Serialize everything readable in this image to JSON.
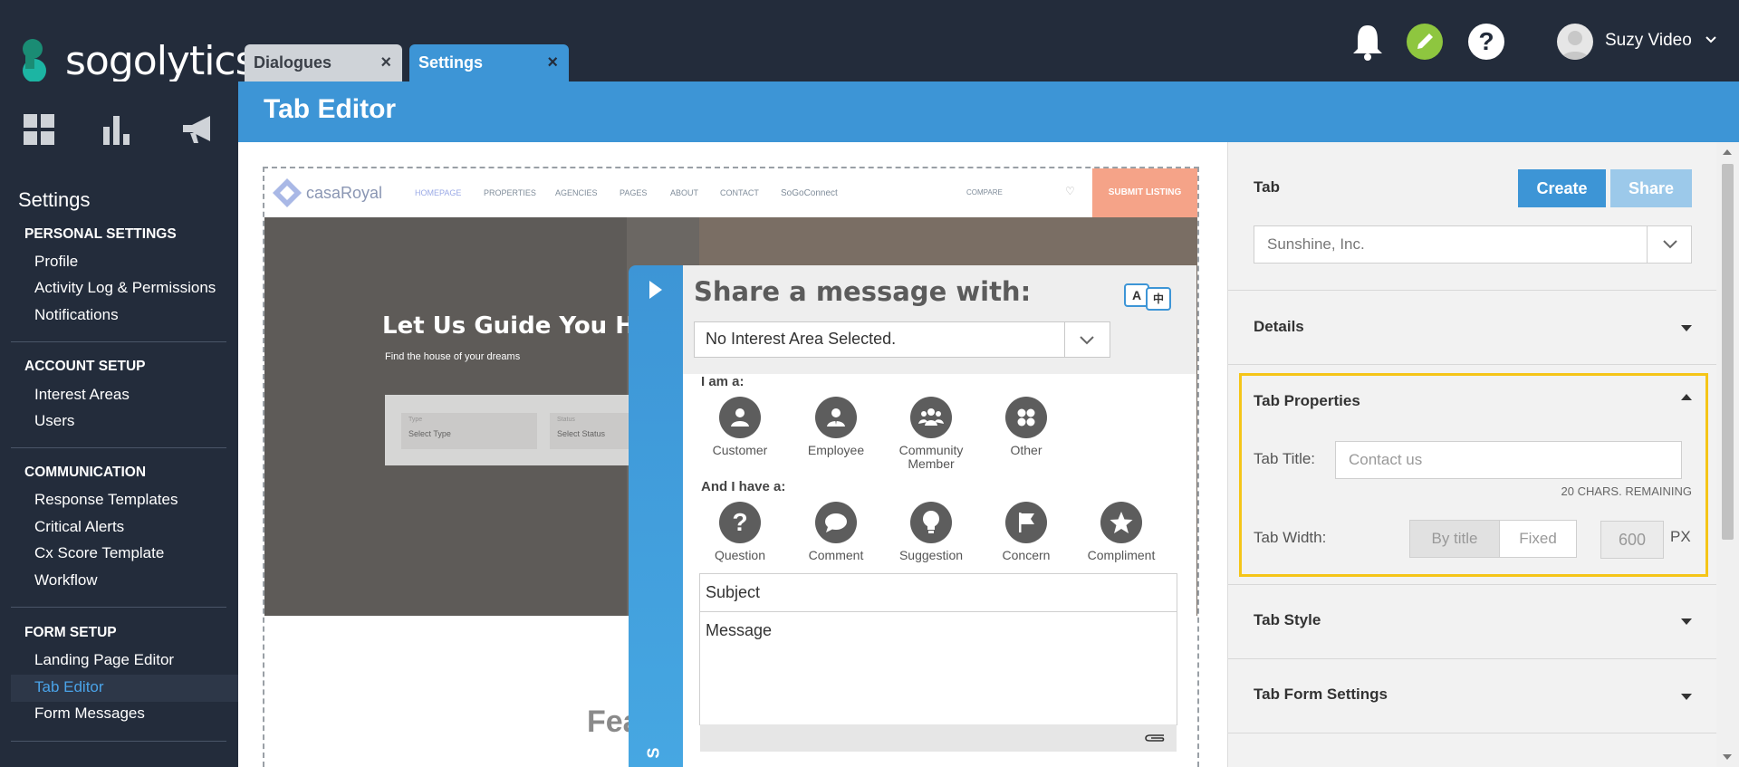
{
  "brand": {
    "name": "sogolytics"
  },
  "tabs": [
    {
      "label": "Dialogues",
      "close": "×"
    },
    {
      "label": "Settings",
      "close": "×"
    }
  ],
  "user": {
    "name": "Suzy Video"
  },
  "topbar": {
    "help_glyph": "?"
  },
  "sidebar": {
    "title": "Settings",
    "sections": [
      {
        "heading": "PERSONAL SETTINGS",
        "items": [
          "Profile",
          "Activity Log & Permissions",
          "Notifications"
        ]
      },
      {
        "heading": "ACCOUNT SETUP",
        "items": [
          "Interest Areas",
          "Users"
        ]
      },
      {
        "heading": "COMMUNICATION",
        "items": [
          "Response Templates",
          "Critical Alerts",
          "Cx Score Template",
          "Workflow"
        ]
      },
      {
        "heading": "FORM SETUP",
        "items": [
          "Landing Page Editor",
          "Tab Editor",
          "Form Messages"
        ]
      }
    ],
    "active_item": "Tab Editor"
  },
  "header": {
    "title": "Tab Editor"
  },
  "preview": {
    "site_logo": "casaRoyal",
    "nav": [
      "HOMEPAGE",
      "PROPERTIES",
      "AGENCIES",
      "PAGES",
      "ABOUT",
      "CONTACT",
      "SoGoConnect",
      "COMPARE"
    ],
    "submit": "SUBMIT LISTING",
    "hero_title": "Let Us Guide You Home",
    "hero_sub": "Find the house of your dreams",
    "type_label": "Type",
    "type_select": "Select Type",
    "status_label": "Status",
    "status_select": "Select Status",
    "fea": "Fea",
    "strip_letter": "S"
  },
  "widget": {
    "title": "Share a message with:",
    "lang_a": "A",
    "lang_b": "中",
    "interest_select": "No Interest Area Selected.",
    "i_am_label": "I am a:",
    "i_am_options": [
      "Customer",
      "Employee",
      "Community Member",
      "Other"
    ],
    "have_label": "And I have a:",
    "have_options": [
      "Question",
      "Comment",
      "Suggestion",
      "Concern",
      "Compliment"
    ],
    "subject_placeholder": "Subject",
    "message_placeholder": "Message"
  },
  "panel": {
    "tab_label": "Tab",
    "create_label": "Create",
    "share_label": "Share",
    "company_select": "Sunshine, Inc.",
    "details_label": "Details",
    "tab_properties_label": "Tab Properties",
    "tab_title_label": "Tab Title:",
    "tab_title_placeholder": "Contact us",
    "chars_remaining": "20 CHARS. REMAINING",
    "tab_width_label": "Tab Width:",
    "width_by_title": "By title",
    "width_fixed": "Fixed",
    "width_px_value": "600",
    "width_px_unit": "PX",
    "tab_style_label": "Tab Style",
    "tab_form_settings_label": "Tab Form Settings"
  },
  "colors": {
    "topbar": "#232c3b",
    "accent": "#3d95d6",
    "pencil": "#8ec63f",
    "highlight": "#f5c518",
    "submit": "#f5a388"
  }
}
